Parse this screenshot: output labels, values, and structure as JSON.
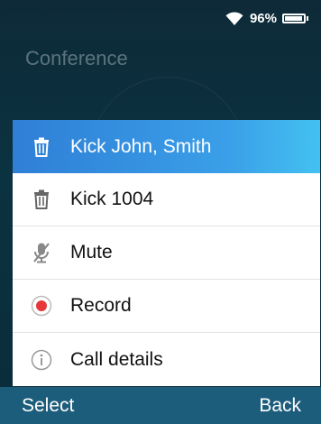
{
  "status_bar": {
    "battery_text": "96%",
    "battery_level": 0.96
  },
  "background": {
    "title": "Conference"
  },
  "menu": {
    "items": [
      {
        "label": "Kick John, Smith",
        "icon": "trash-icon",
        "selected": true
      },
      {
        "label": "Kick 1004",
        "icon": "trash-icon",
        "selected": false
      },
      {
        "label": "Mute",
        "icon": "mic-off-icon",
        "selected": false
      },
      {
        "label": "Record",
        "icon": "record-icon",
        "selected": false
      },
      {
        "label": "Call details",
        "icon": "info-icon",
        "selected": false
      }
    ]
  },
  "softkeys": {
    "left": "Select",
    "right": "Back"
  },
  "colors": {
    "selected_start": "#2f7fd6",
    "selected_end": "#43c1f0",
    "softkey_bar": "#1d5d7c",
    "record_red": "#e5383b"
  }
}
